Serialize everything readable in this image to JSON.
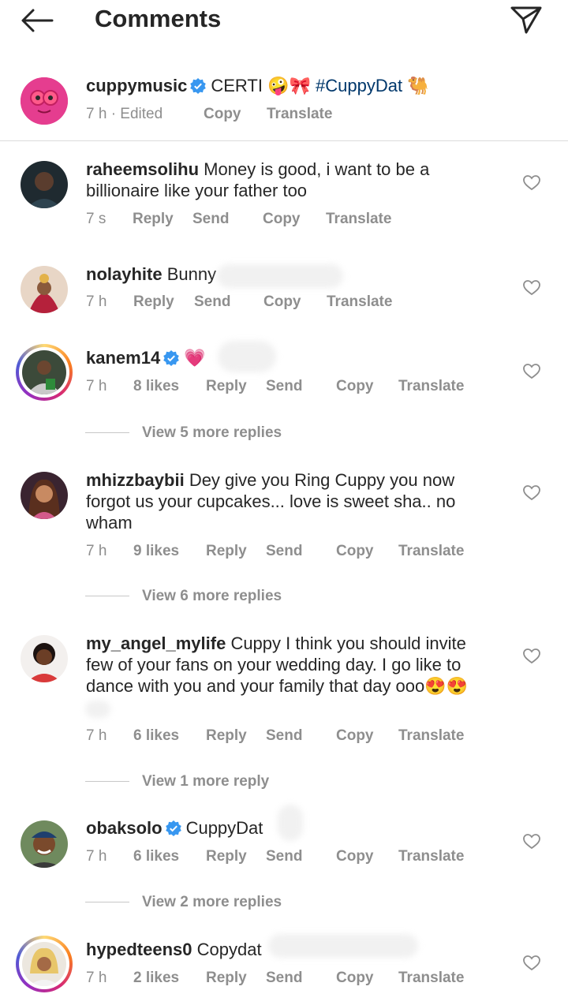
{
  "header": {
    "title": "Comments"
  },
  "caption": {
    "username": "cuppymusic",
    "text": "CERTI",
    "emojis": "🤪🎀",
    "hashtag": "#CuppyDat",
    "trailing_emoji": "🐫",
    "time": "7 h · Edited",
    "copy": "Copy",
    "translate": "Translate"
  },
  "comments": [
    {
      "username": "raheemsolihu",
      "text": "Money is good, i want to be a billionaire like your father too",
      "time": "7 s",
      "likes": "",
      "reply": "Reply",
      "send": "Send",
      "copy": "Copy",
      "translate": "Translate"
    },
    {
      "username": "nolayhite",
      "text": "Bunny",
      "time": "7 h",
      "likes": "",
      "reply": "Reply",
      "send": "Send",
      "copy": "Copy",
      "translate": "Translate"
    },
    {
      "username": "kanem14",
      "text": "💗",
      "time": "7 h",
      "likes": "8 likes",
      "reply": "Reply",
      "send": "Send",
      "copy": "Copy",
      "translate": "Translate",
      "view_more": "View 5 more replies"
    },
    {
      "username": "mhizzbaybii",
      "text": "Dey give you Ring Cuppy you now forgot us your cupcakes... love is sweet sha.. no wham",
      "time": "7 h",
      "likes": "9 likes",
      "reply": "Reply",
      "send": "Send",
      "copy": "Copy",
      "translate": "Translate",
      "view_more": "View 6 more replies"
    },
    {
      "username": "my_angel_mylife",
      "text": "Cuppy I think you should invite few of your fans on your wedding day. I go like to dance with you and your family that day ooo😍😍",
      "time": "7 h",
      "likes": "6 likes",
      "reply": "Reply",
      "send": "Send",
      "copy": "Copy",
      "translate": "Translate",
      "view_more": "View 1 more reply"
    },
    {
      "username": "obaksolo",
      "text": "CuppyDat",
      "time": "7 h",
      "likes": "6 likes",
      "reply": "Reply",
      "send": "Send",
      "copy": "Copy",
      "translate": "Translate",
      "view_more": "View 2 more replies"
    },
    {
      "username": "hypedteens0",
      "text": "Copydat",
      "time": "7 h",
      "likes": "2 likes",
      "reply": "Reply",
      "send": "Send",
      "copy": "Copy",
      "translate": "Translate"
    }
  ],
  "colors": {
    "verified": "#3897f0",
    "hashtag": "#00376b",
    "meta": "#8e8e8e"
  }
}
